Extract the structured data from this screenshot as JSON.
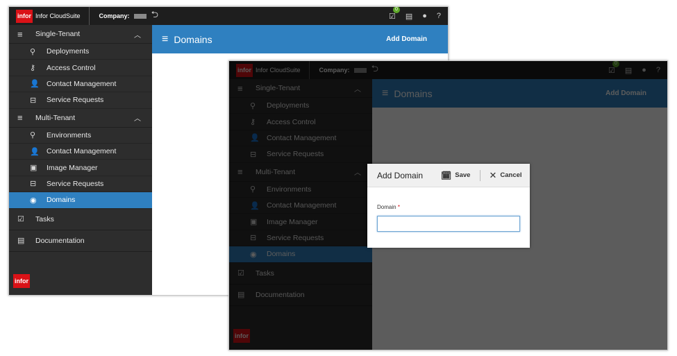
{
  "app": {
    "logo_text": "infor",
    "brand": "Infor CloudSuite",
    "company_label": "Company:",
    "notification_count": "0"
  },
  "sidebar": {
    "single_tenant": {
      "label": "Single-Tenant",
      "items": [
        "Deployments",
        "Access Control",
        "Contact Management",
        "Service Requests"
      ]
    },
    "multi_tenant": {
      "label": "Multi-Tenant",
      "items": [
        "Environments",
        "Contact Management",
        "Image Manager",
        "Service Requests",
        "Domains"
      ]
    },
    "tasks": "Tasks",
    "documentation": "Documentation"
  },
  "header": {
    "title": "Domains",
    "add_button": "Add Domain"
  },
  "modal": {
    "title": "Add Domain",
    "save": "Save",
    "cancel": "Cancel",
    "field_label": "Domain",
    "required_mark": "*",
    "field_value": ""
  }
}
